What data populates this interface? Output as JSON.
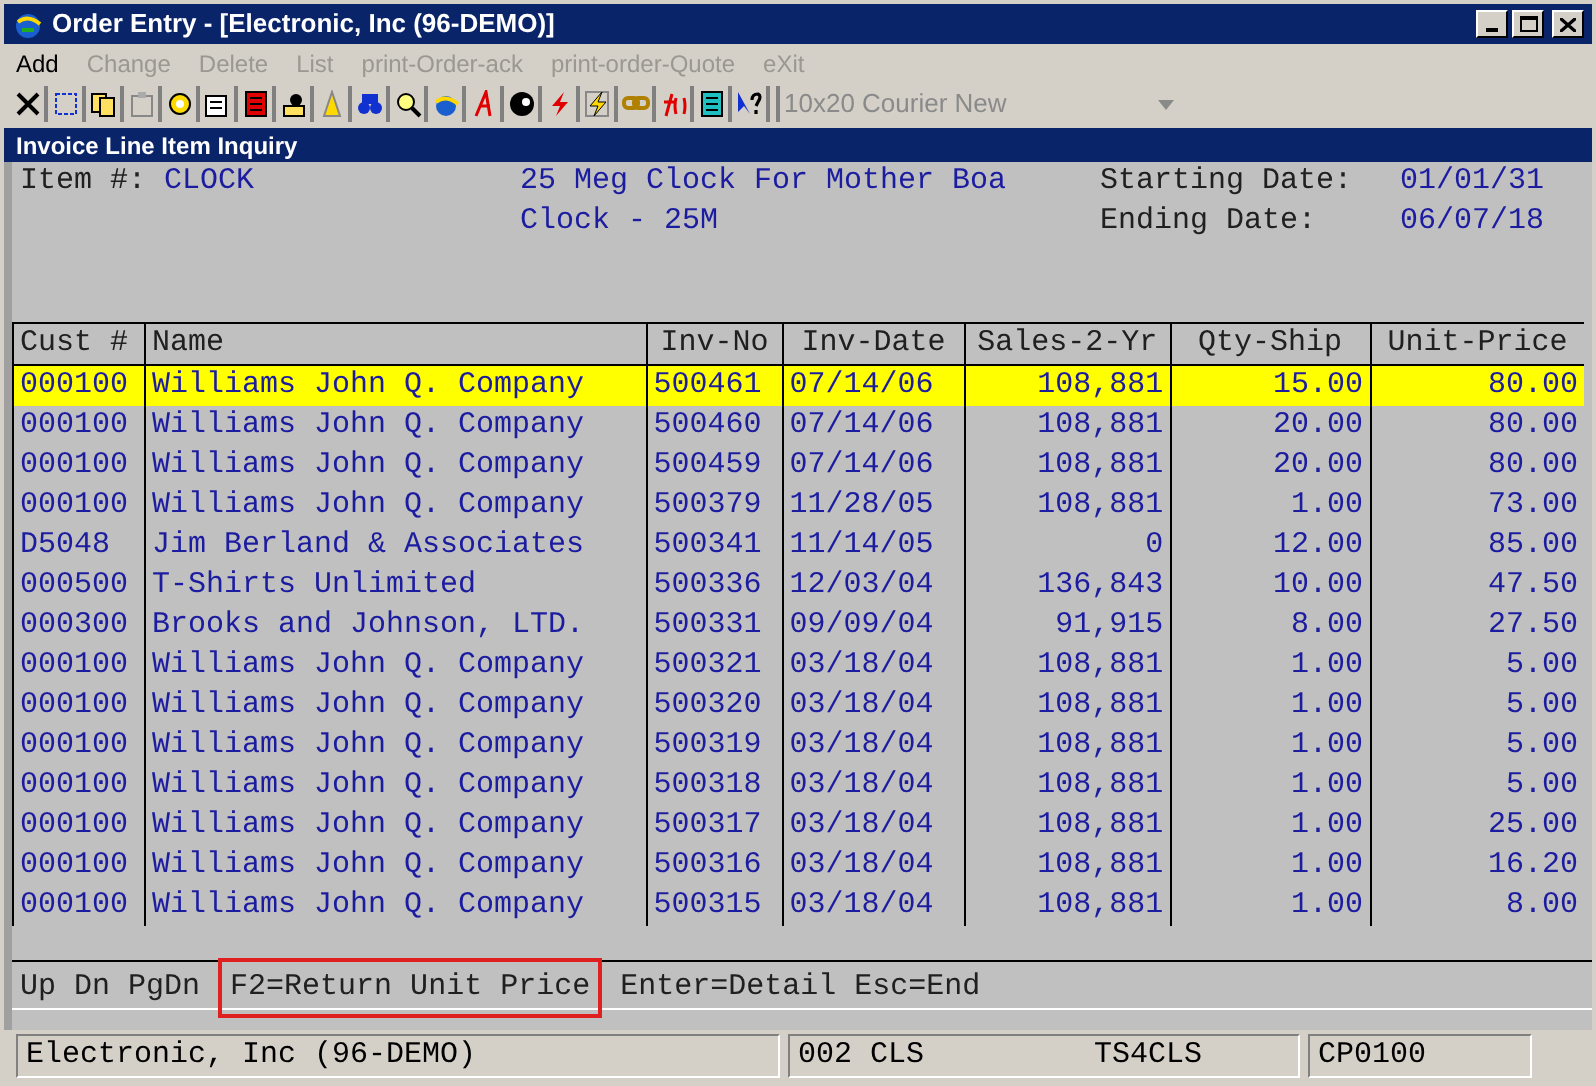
{
  "window": {
    "title": "Order Entry - [Electronic, Inc (96-DEMO)]"
  },
  "menu": [
    {
      "label": "Add",
      "disabled": false
    },
    {
      "label": "Change",
      "disabled": true
    },
    {
      "label": "Delete",
      "disabled": true
    },
    {
      "label": "List",
      "disabled": true
    },
    {
      "label": "print-Order-ack",
      "disabled": true
    },
    {
      "label": "print-order-Quote",
      "disabled": true
    },
    {
      "label": "eXit",
      "disabled": true
    }
  ],
  "toolbar": {
    "font_select": "10x20 Courier New"
  },
  "panel": {
    "title": "Invoice Line Item Inquiry"
  },
  "header": {
    "item_label": "Item #:",
    "item_value": "CLOCK",
    "description_1": "25 Meg Clock For Mother Boa",
    "description_2": "Clock - 25M",
    "start_label": "Starting Date:",
    "start_value": "01/01/31",
    "end_label": "Ending Date:",
    "end_value": "06/07/18"
  },
  "table": {
    "columns": [
      "Cust #",
      "Name",
      "Inv-No",
      "Inv-Date",
      "Sales-2-Yr",
      "Qty-Ship",
      "Unit-Price"
    ],
    "rows": [
      {
        "selected": true,
        "cells": [
          "000100",
          "Williams John Q. Company",
          "500461",
          "07/14/06",
          "108,881",
          "15.00",
          "80.00"
        ]
      },
      {
        "selected": false,
        "cells": [
          "000100",
          "Williams John Q. Company",
          "500460",
          "07/14/06",
          "108,881",
          "20.00",
          "80.00"
        ]
      },
      {
        "selected": false,
        "cells": [
          "000100",
          "Williams John Q. Company",
          "500459",
          "07/14/06",
          "108,881",
          "20.00",
          "80.00"
        ]
      },
      {
        "selected": false,
        "cells": [
          "000100",
          "Williams John Q. Company",
          "500379",
          "11/28/05",
          "108,881",
          "1.00",
          "73.00"
        ]
      },
      {
        "selected": false,
        "cells": [
          "D5048",
          "Jim Berland & Associates",
          "500341",
          "11/14/05",
          "0",
          "12.00",
          "85.00"
        ]
      },
      {
        "selected": false,
        "cells": [
          "000500",
          "T-Shirts Unlimited",
          "500336",
          "12/03/04",
          "136,843",
          "10.00",
          "47.50"
        ]
      },
      {
        "selected": false,
        "cells": [
          "000300",
          "Brooks and Johnson, LTD.",
          "500331",
          "09/09/04",
          "91,915",
          "8.00",
          "27.50"
        ]
      },
      {
        "selected": false,
        "cells": [
          "000100",
          "Williams John Q. Company",
          "500321",
          "03/18/04",
          "108,881",
          "1.00",
          "5.00"
        ]
      },
      {
        "selected": false,
        "cells": [
          "000100",
          "Williams John Q. Company",
          "500320",
          "03/18/04",
          "108,881",
          "1.00",
          "5.00"
        ]
      },
      {
        "selected": false,
        "cells": [
          "000100",
          "Williams John Q. Company",
          "500319",
          "03/18/04",
          "108,881",
          "1.00",
          "5.00"
        ]
      },
      {
        "selected": false,
        "cells": [
          "000100",
          "Williams John Q. Company",
          "500318",
          "03/18/04",
          "108,881",
          "1.00",
          "5.00"
        ]
      },
      {
        "selected": false,
        "cells": [
          "000100",
          "Williams John Q. Company",
          "500317",
          "03/18/04",
          "108,881",
          "1.00",
          "25.00"
        ]
      },
      {
        "selected": false,
        "cells": [
          "000100",
          "Williams John Q. Company",
          "500316",
          "03/18/04",
          "108,881",
          "1.00",
          "16.20"
        ]
      },
      {
        "selected": false,
        "cells": [
          "000100",
          "Williams John Q. Company",
          "500315",
          "03/18/04",
          "108,881",
          "1.00",
          "8.00"
        ]
      }
    ]
  },
  "keys": [
    {
      "label": "Up",
      "highlighted": false
    },
    {
      "label": "Dn",
      "highlighted": false
    },
    {
      "label": "PgDn",
      "highlighted": false
    },
    {
      "label": "F2=Return Unit Price",
      "highlighted": true
    },
    {
      "label": "Enter=Detail",
      "highlighted": false
    },
    {
      "label": "Esc=End",
      "highlighted": false
    }
  ],
  "status_bar": {
    "company": "Electronic, Inc (96-DEMO)",
    "code": "002 CLS",
    "terminal": "TS4CLS",
    "program": "CP0100"
  }
}
